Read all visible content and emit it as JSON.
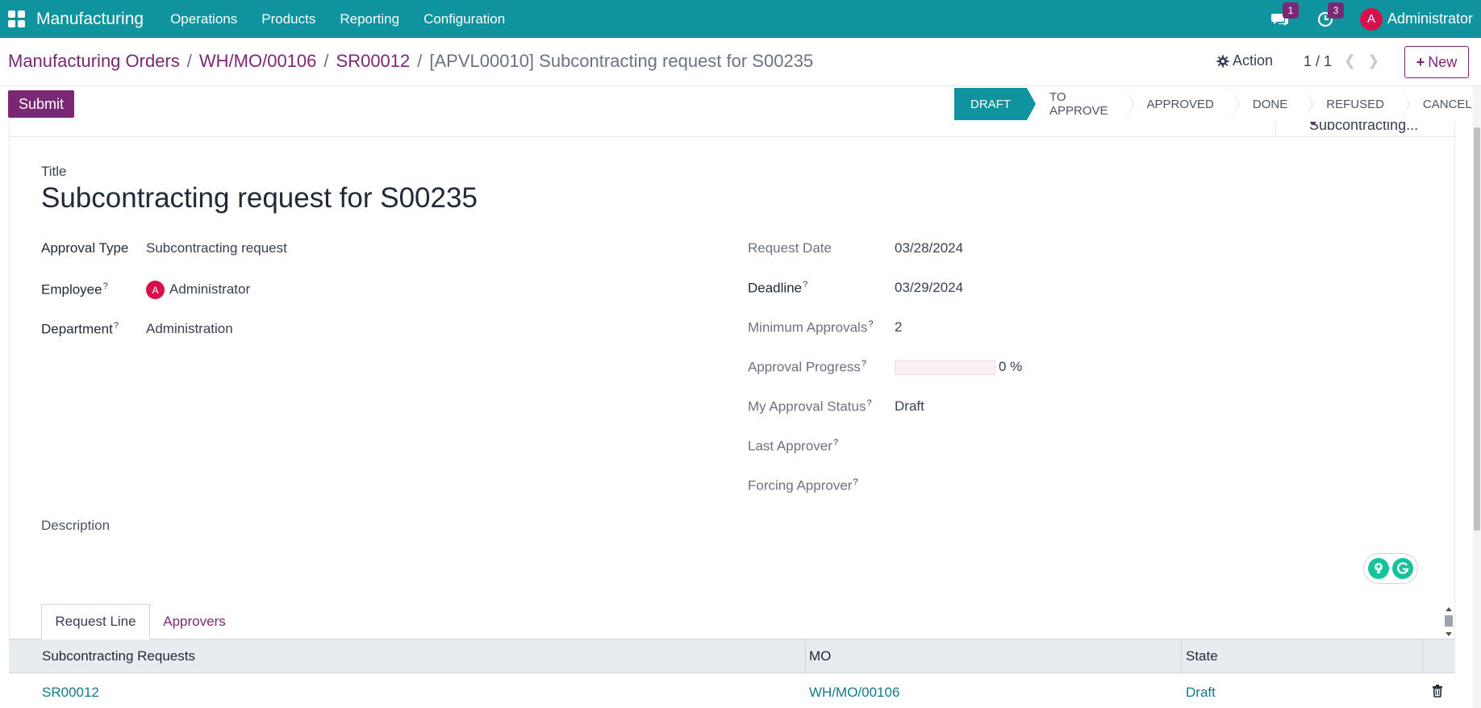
{
  "navbar": {
    "app_name": "Manufacturing",
    "menu": [
      "Operations",
      "Products",
      "Reporting",
      "Configuration"
    ],
    "messages_count": "1",
    "activities_count": "3",
    "user_initial": "A",
    "user_name": "Administrator",
    "color": "#0f939e"
  },
  "breadcrumb": {
    "items": [
      "Manufacturing Orders",
      "WH/MO/00106",
      "SR00012"
    ],
    "separator": "/",
    "current": "[APVL00010] Subcontracting request for S00235"
  },
  "control": {
    "action_label": "Action",
    "pager": "1 / 1",
    "new_label": "New"
  },
  "status": {
    "submit_label": "Submit",
    "stages": [
      "Draft",
      "To Approve",
      "Approved",
      "Done",
      "Refused",
      "Cancelled"
    ],
    "active_stage": "Draft"
  },
  "smart_button": {
    "label": "Subcontracting..."
  },
  "form": {
    "title_label": "Title",
    "title": "Subcontracting request for S00235",
    "left": {
      "approval_type_label": "Approval Type",
      "approval_type": "Subcontracting request",
      "employee_label": "Employee",
      "employee_initial": "A",
      "employee": "Administrator",
      "department_label": "Department",
      "department": "Administration"
    },
    "right": {
      "request_date_label": "Request Date",
      "request_date": "03/28/2024",
      "deadline_label": "Deadline",
      "deadline": "03/29/2024",
      "min_approvals_label": "Minimum Approvals",
      "min_approvals": "2",
      "approval_progress_label": "Approval Progress",
      "approval_progress": 0,
      "approval_progress_text": "0 %",
      "my_status_label": "My Approval Status",
      "my_status": "Draft",
      "last_approver_label": "Last Approver",
      "forcing_approver_label": "Forcing Approver"
    },
    "description_label": "Description",
    "help_marker": "?"
  },
  "tabs": [
    "Request Line",
    "Approvers"
  ],
  "table": {
    "columns": [
      "Subcontracting Requests",
      "MO",
      "State"
    ],
    "rows": [
      [
        "SR00012",
        "WH/MO/00106",
        "Draft"
      ]
    ]
  },
  "colors": {
    "accent": "#7b2874",
    "link": "#0e7d8a",
    "avatar": "#d6114d"
  }
}
